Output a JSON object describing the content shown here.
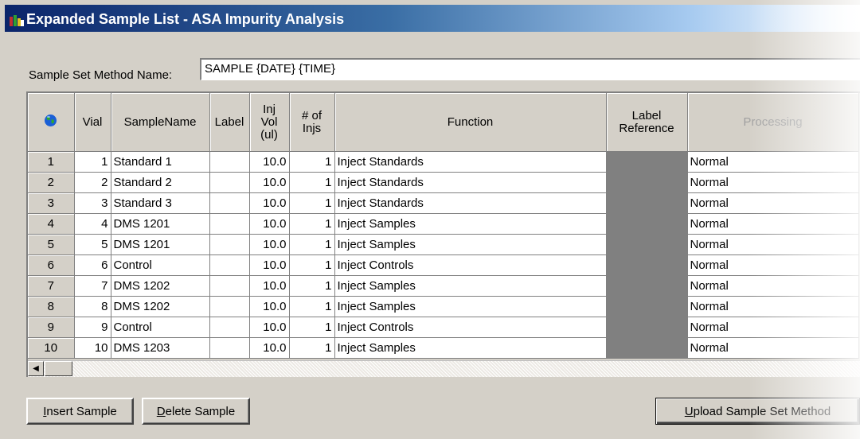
{
  "window": {
    "title": "Expanded Sample List - ASA Impurity Analysis"
  },
  "method": {
    "label": "Sample Set Method Name:",
    "value": "SAMPLE {DATE} {TIME}"
  },
  "table": {
    "columns": {
      "vial": "Vial",
      "sample_name": "SampleName",
      "label": "Label",
      "inj_vol": [
        "Inj",
        "Vol",
        "(ul)"
      ],
      "num_injs": [
        "# of",
        "Injs"
      ],
      "function": "Function",
      "label_reference": [
        "Label",
        "Reference"
      ],
      "processing": "Processing"
    },
    "rows": [
      {
        "row": "1",
        "vial": "1",
        "sample_name": "Standard 1",
        "label": "",
        "inj_vol": "10.0",
        "num_injs": "1",
        "function": "Inject Standards",
        "processing": "Normal"
      },
      {
        "row": "2",
        "vial": "2",
        "sample_name": "Standard 2",
        "label": "",
        "inj_vol": "10.0",
        "num_injs": "1",
        "function": "Inject Standards",
        "processing": "Normal"
      },
      {
        "row": "3",
        "vial": "3",
        "sample_name": "Standard 3",
        "label": "",
        "inj_vol": "10.0",
        "num_injs": "1",
        "function": "Inject Standards",
        "processing": "Normal"
      },
      {
        "row": "4",
        "vial": "4",
        "sample_name": "DMS 1201",
        "label": "",
        "inj_vol": "10.0",
        "num_injs": "1",
        "function": "Inject Samples",
        "processing": "Normal"
      },
      {
        "row": "5",
        "vial": "5",
        "sample_name": "DMS 1201",
        "label": "",
        "inj_vol": "10.0",
        "num_injs": "1",
        "function": "Inject Samples",
        "processing": "Normal"
      },
      {
        "row": "6",
        "vial": "6",
        "sample_name": "Control",
        "label": "",
        "inj_vol": "10.0",
        "num_injs": "1",
        "function": "Inject Controls",
        "processing": "Normal"
      },
      {
        "row": "7",
        "vial": "7",
        "sample_name": "DMS 1202",
        "label": "",
        "inj_vol": "10.0",
        "num_injs": "1",
        "function": "Inject Samples",
        "processing": "Normal"
      },
      {
        "row": "8",
        "vial": "8",
        "sample_name": "DMS 1202",
        "label": "",
        "inj_vol": "10.0",
        "num_injs": "1",
        "function": "Inject Samples",
        "processing": "Normal"
      },
      {
        "row": "9",
        "vial": "9",
        "sample_name": "Control",
        "label": "",
        "inj_vol": "10.0",
        "num_injs": "1",
        "function": "Inject Controls",
        "processing": "Normal"
      },
      {
        "row": "10",
        "vial": "10",
        "sample_name": "DMS 1203",
        "label": "",
        "inj_vol": "10.0",
        "num_injs": "1",
        "function": "Inject Samples",
        "processing": "Normal"
      }
    ]
  },
  "buttons": {
    "insert": {
      "accel": "I",
      "rest": "nsert Sample"
    },
    "delete": {
      "accel": "D",
      "rest": "elete Sample"
    },
    "upload": {
      "accel": "U",
      "rest": "pload Sample Set Method"
    }
  },
  "colors": {
    "title_gradient_start": "#0a246a",
    "face": "#d4d0c8",
    "label_reference_cell": "#808080"
  },
  "icons": {
    "title": "app-icon",
    "header_corner": "globe-icon",
    "scroll_left": "arrow-left-icon"
  }
}
